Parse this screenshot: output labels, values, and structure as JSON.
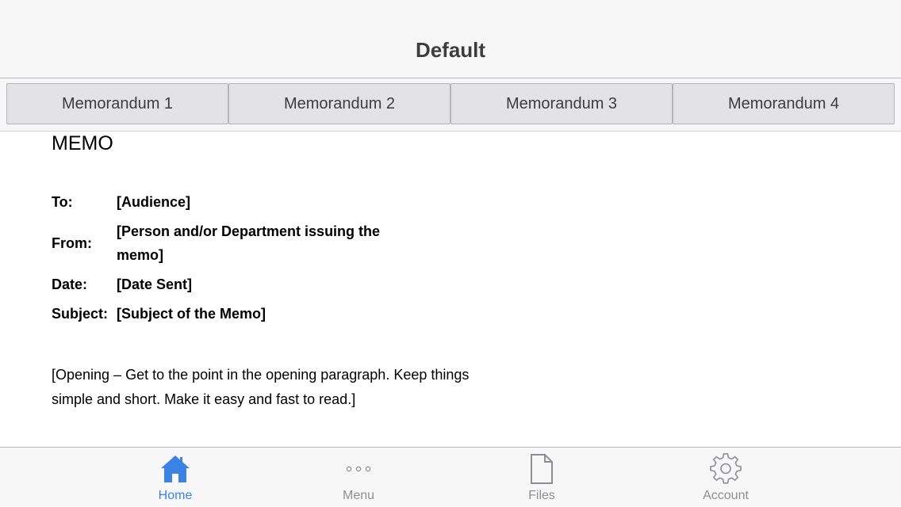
{
  "header": {
    "title": "Default"
  },
  "tabs": [
    {
      "label": "Memorandum 1"
    },
    {
      "label": "Memorandum 2"
    },
    {
      "label": "Memorandum 3"
    },
    {
      "label": "Memorandum 4"
    }
  ],
  "memo": {
    "heading": "MEMO",
    "fields": [
      {
        "label": "To:",
        "value": "[Audience]"
      },
      {
        "label": "From:",
        "value": "[Person and/or Department issuing the memo]"
      },
      {
        "label": "Date:",
        "value": "[Date Sent]"
      },
      {
        "label": "Subject:",
        "value": "[Subject of the Memo]"
      }
    ],
    "opening": "[Opening – Get to the point in the opening paragraph. Keep things simple and short. Make it easy and fast to read.]"
  },
  "bottom_nav": {
    "active_color": "#3a82e3",
    "inactive_color": "#8e8e93",
    "items": [
      {
        "label": "Home",
        "icon": "home-icon",
        "active": true
      },
      {
        "label": "Menu",
        "icon": "more-dots-icon",
        "active": false
      },
      {
        "label": "Files",
        "icon": "file-icon",
        "active": false
      },
      {
        "label": "Account",
        "icon": "gear-icon",
        "active": false
      }
    ]
  }
}
